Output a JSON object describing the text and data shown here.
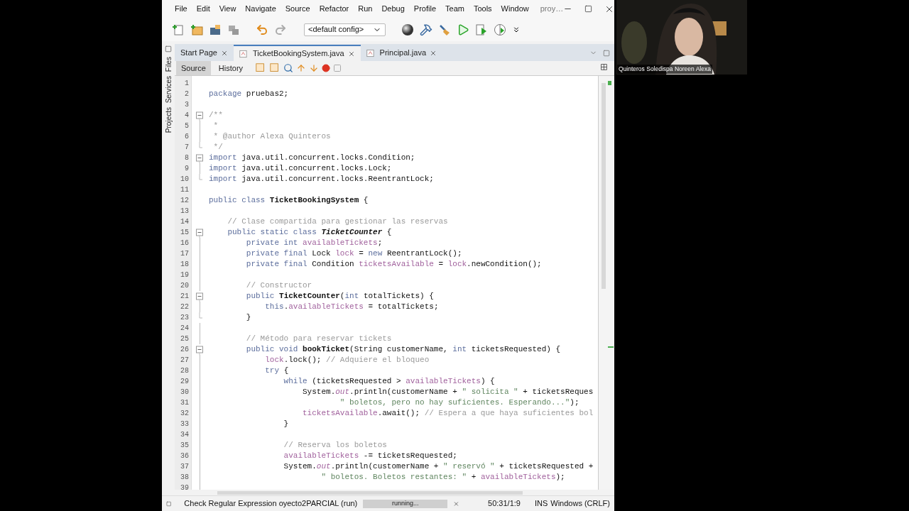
{
  "menu": {
    "items": [
      "File",
      "Edit",
      "View",
      "Navigate",
      "Source",
      "Refactor",
      "Run",
      "Debug",
      "Profile",
      "Team",
      "Tools",
      "Window"
    ],
    "title": "proy…"
  },
  "toolbar": {
    "config": "<default config>"
  },
  "tabs": [
    {
      "label": "Start Page",
      "selected": false
    },
    {
      "label": "TicketBookingSystem.java",
      "selected": true
    },
    {
      "label": "Principal.java",
      "selected": false
    }
  ],
  "editor_tabs": [
    {
      "label": "Source",
      "selected": true
    },
    {
      "label": "History",
      "selected": false
    }
  ],
  "side_panels": [
    "Files",
    "Services",
    "Projects"
  ],
  "code": [
    {
      "n": "1"
    },
    {
      "n": "2",
      "t": [
        {
          "kind": "kw",
          "s": "package "
        },
        {
          "kind": "p",
          "s": "pruebas2;"
        }
      ]
    },
    {
      "n": "3"
    },
    {
      "n": "4",
      "fold": {
        "kind": "start"
      },
      "t": [
        {
          "kind": "c",
          "s": "/**"
        }
      ]
    },
    {
      "n": "5",
      "fold": {
        "kind": "line"
      },
      "t": [
        {
          "kind": "c",
          "s": " *"
        }
      ]
    },
    {
      "n": "6",
      "fold": {
        "kind": "line"
      },
      "t": [
        {
          "kind": "c",
          "s": " * @author Alexa Quinteros"
        }
      ]
    },
    {
      "n": "7",
      "fold": {
        "kind": "end"
      },
      "t": [
        {
          "kind": "c",
          "s": " */"
        }
      ]
    },
    {
      "n": "8",
      "fold": {
        "kind": "start"
      },
      "t": [
        {
          "kind": "kw",
          "s": "import "
        },
        {
          "kind": "p",
          "s": "java.util.concurrent.locks.Condition;"
        }
      ]
    },
    {
      "n": "9",
      "fold": {
        "kind": "line"
      },
      "t": [
        {
          "kind": "kw",
          "s": "import "
        },
        {
          "kind": "p",
          "s": "java.util.concurrent.locks.Lock;"
        }
      ]
    },
    {
      "n": "10",
      "fold": {
        "kind": "end"
      },
      "t": [
        {
          "kind": "kw",
          "s": "import "
        },
        {
          "kind": "p",
          "s": "java.util.concurrent.locks.ReentrantLock;"
        }
      ]
    },
    {
      "n": "11"
    },
    {
      "n": "12",
      "t": [
        {
          "kind": "kw",
          "s": "public class "
        },
        {
          "kind": "b",
          "s": "TicketBookingSystem"
        },
        {
          "kind": "p",
          "s": " {"
        }
      ]
    },
    {
      "n": "13"
    },
    {
      "n": "14",
      "t": [
        {
          "kind": "c",
          "s": "    // Clase compartida para gestionar las reservas"
        }
      ]
    },
    {
      "n": "15",
      "fold": {
        "kind": "start"
      },
      "t": [
        {
          "kind": "kw",
          "s": "    public static class "
        },
        {
          "kind": "bi",
          "s": "TicketCounter"
        },
        {
          "kind": "p",
          "s": " {"
        }
      ]
    },
    {
      "n": "16",
      "fold": {
        "kind": "line"
      },
      "t": [
        {
          "kind": "kw",
          "s": "        private int "
        },
        {
          "kind": "f",
          "s": "availableTickets"
        },
        {
          "kind": "p",
          "s": ";"
        }
      ]
    },
    {
      "n": "17",
      "fold": {
        "kind": "line"
      },
      "t": [
        {
          "kind": "kw",
          "s": "        private final "
        },
        {
          "kind": "p",
          "s": "Lock "
        },
        {
          "kind": "f",
          "s": "lock"
        },
        {
          "kind": "p",
          "s": " = "
        },
        {
          "kind": "kw",
          "s": "new "
        },
        {
          "kind": "p",
          "s": "ReentrantLock();"
        }
      ]
    },
    {
      "n": "18",
      "fold": {
        "kind": "line"
      },
      "t": [
        {
          "kind": "kw",
          "s": "        private final "
        },
        {
          "kind": "p",
          "s": "Condition "
        },
        {
          "kind": "f",
          "s": "ticketsAvailable"
        },
        {
          "kind": "p",
          "s": " = "
        },
        {
          "kind": "f",
          "s": "lock"
        },
        {
          "kind": "p",
          "s": ".newCondition();"
        }
      ]
    },
    {
      "n": "19",
      "fold": {
        "kind": "line"
      }
    },
    {
      "n": "20",
      "fold": {
        "kind": "line"
      },
      "t": [
        {
          "kind": "c",
          "s": "        // Constructor"
        }
      ]
    },
    {
      "n": "21",
      "fold": {
        "kind": "start"
      },
      "t": [
        {
          "kind": "kw",
          "s": "        public "
        },
        {
          "kind": "b",
          "s": "TicketCounter"
        },
        {
          "kind": "p",
          "s": "("
        },
        {
          "kind": "kw",
          "s": "int "
        },
        {
          "kind": "p",
          "s": "totalTickets) {"
        }
      ]
    },
    {
      "n": "22",
      "fold": {
        "kind": "line"
      },
      "t": [
        {
          "kind": "kw",
          "s": "            this"
        },
        {
          "kind": "p",
          "s": "."
        },
        {
          "kind": "f",
          "s": "availableTickets"
        },
        {
          "kind": "p",
          "s": " = totalTickets;"
        }
      ]
    },
    {
      "n": "23",
      "fold": {
        "kind": "end"
      },
      "t": [
        {
          "kind": "p",
          "s": "        }"
        }
      ]
    },
    {
      "n": "24",
      "fold": {
        "kind": "line"
      }
    },
    {
      "n": "25",
      "fold": {
        "kind": "line"
      },
      "t": [
        {
          "kind": "c",
          "s": "        // Método para reservar tickets"
        }
      ]
    },
    {
      "n": "26",
      "fold": {
        "kind": "start"
      },
      "t": [
        {
          "kind": "kw",
          "s": "        public void "
        },
        {
          "kind": "b",
          "s": "bookTicket"
        },
        {
          "kind": "p",
          "s": "(String customerName, "
        },
        {
          "kind": "kw",
          "s": "int "
        },
        {
          "kind": "p",
          "s": "ticketsRequested) {"
        }
      ]
    },
    {
      "n": "27",
      "fold": {
        "kind": "line"
      },
      "t": [
        {
          "kind": "f",
          "s": "            lock"
        },
        {
          "kind": "p",
          "s": ".lock(); "
        },
        {
          "kind": "c",
          "s": "// Adquiere el bloqueo"
        }
      ]
    },
    {
      "n": "28",
      "fold": {
        "kind": "line"
      },
      "t": [
        {
          "kind": "kw",
          "s": "            try "
        },
        {
          "kind": "p",
          "s": "{"
        }
      ]
    },
    {
      "n": "29",
      "fold": {
        "kind": "line"
      },
      "t": [
        {
          "kind": "kw",
          "s": "                while "
        },
        {
          "kind": "p",
          "s": "(ticketsRequested > "
        },
        {
          "kind": "f",
          "s": "availableTickets"
        },
        {
          "kind": "p",
          "s": ") {"
        }
      ]
    },
    {
      "n": "30",
      "fold": {
        "kind": "line"
      },
      "t": [
        {
          "kind": "p",
          "s": "                    System."
        },
        {
          "kind": "si",
          "s": "out"
        },
        {
          "kind": "p",
          "s": ".println(customerName + "
        },
        {
          "kind": "s",
          "s": "\" solicita \""
        },
        {
          "kind": "p",
          "s": " + ticketsReques"
        }
      ]
    },
    {
      "n": "31",
      "fold": {
        "kind": "line"
      },
      "t": [
        {
          "kind": "s",
          "s": "                            \" boletos, pero no hay suficientes. Esperando...\""
        },
        {
          "kind": "p",
          "s": ");"
        }
      ]
    },
    {
      "n": "32",
      "fold": {
        "kind": "line"
      },
      "t": [
        {
          "kind": "f",
          "s": "                    ticketsAvailable"
        },
        {
          "kind": "p",
          "s": ".await(); "
        },
        {
          "kind": "c",
          "s": "// Espera a que haya suficientes bol"
        }
      ]
    },
    {
      "n": "33",
      "fold": {
        "kind": "line"
      },
      "t": [
        {
          "kind": "p",
          "s": "                }"
        }
      ]
    },
    {
      "n": "34",
      "fold": {
        "kind": "line"
      }
    },
    {
      "n": "35",
      "fold": {
        "kind": "line"
      },
      "t": [
        {
          "kind": "c",
          "s": "                // Reserva los boletos"
        }
      ]
    },
    {
      "n": "36",
      "fold": {
        "kind": "line"
      },
      "t": [
        {
          "kind": "f",
          "s": "                availableTickets"
        },
        {
          "kind": "p",
          "s": " -= ticketsRequested;"
        }
      ]
    },
    {
      "n": "37",
      "fold": {
        "kind": "line"
      },
      "t": [
        {
          "kind": "p",
          "s": "                System."
        },
        {
          "kind": "si",
          "s": "out"
        },
        {
          "kind": "p",
          "s": ".println(customerName + "
        },
        {
          "kind": "s",
          "s": "\" reservó \""
        },
        {
          "kind": "p",
          "s": " + ticketsRequested +"
        }
      ]
    },
    {
      "n": "38",
      "fold": {
        "kind": "line"
      },
      "t": [
        {
          "kind": "s",
          "s": "                        \" boletos. Boletos restantes: \""
        },
        {
          "kind": "p",
          "s": " + "
        },
        {
          "kind": "f",
          "s": "availableTickets"
        },
        {
          "kind": "p",
          "s": ");"
        }
      ]
    },
    {
      "n": "39",
      "fold": {
        "kind": "line"
      }
    }
  ],
  "status_bar": {
    "task": "Check Regular Expression oyecto2PARCIAL (run)",
    "progress": "running...",
    "position": "50:31/1:9",
    "mode": "INS",
    "line_endings": "Windows (CRLF)"
  },
  "video": {
    "name": "Quinteros Soledispa Noreen Alexa"
  }
}
